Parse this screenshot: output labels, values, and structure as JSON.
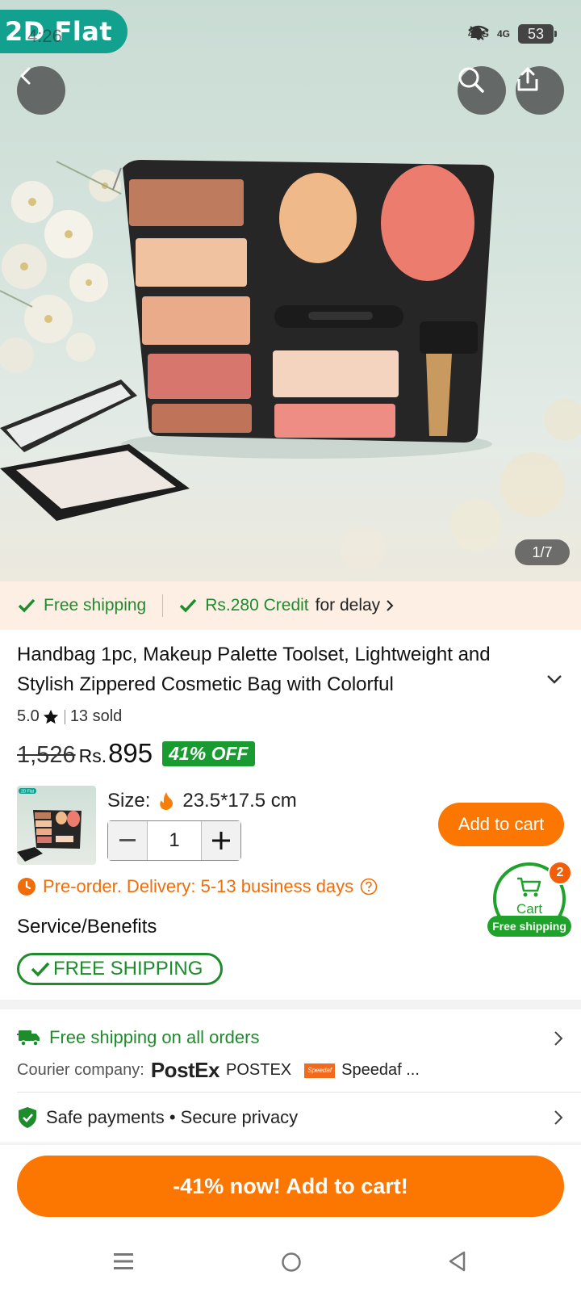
{
  "status_bar": {
    "badge": "2D Flat",
    "time": "4:26",
    "battery": "53",
    "network_1": "4.5G",
    "network_2": "4G"
  },
  "gallery": {
    "counter": "1/7",
    "image_subject": "makeup palette cosmetic bag on mint background with white flowers and compact"
  },
  "benefits_bar": {
    "free_shipping": "Free shipping",
    "credit_highlight": "Rs.280 Credit",
    "credit_suffix": "for delay"
  },
  "product": {
    "title": "Handbag 1pc, Makeup Palette Toolset, Lightweight and Stylish Zippered Cosmetic Bag with Colorful",
    "rating": "5.0",
    "sold": "13 sold",
    "old_price": "1,526",
    "currency": "Rs.",
    "price": "895",
    "discount": "41% OFF",
    "thumb_badge": "2D Flat",
    "size_label": "Size:",
    "size_value": "23.5*17.5 cm",
    "quantity": "1",
    "add_to_cart": "Add to cart",
    "preorder": "Pre-order. Delivery: 5-13 business days"
  },
  "cart_float": {
    "label": "Cart",
    "count": "2",
    "shipping": "Free shipping"
  },
  "service": {
    "title": "Service/Benefits",
    "pill": "FREE SHIPPING"
  },
  "shipping_row": {
    "title": "Free shipping on all orders",
    "courier_label": "Courier company:",
    "courier_logo": "PostEx",
    "courier_1": "POSTEX",
    "courier_2_logo": "Speedaf",
    "courier_2": "Speedaf ..."
  },
  "payments_row": {
    "text": "Safe payments • Secure privacy"
  },
  "cta": {
    "label": "-41% now! Add to cart!"
  },
  "colors": {
    "accent_orange": "#fb7701",
    "green": "#1e8c2c",
    "discount_green": "#1a9b32",
    "banner_bg": "#fdefe4"
  }
}
